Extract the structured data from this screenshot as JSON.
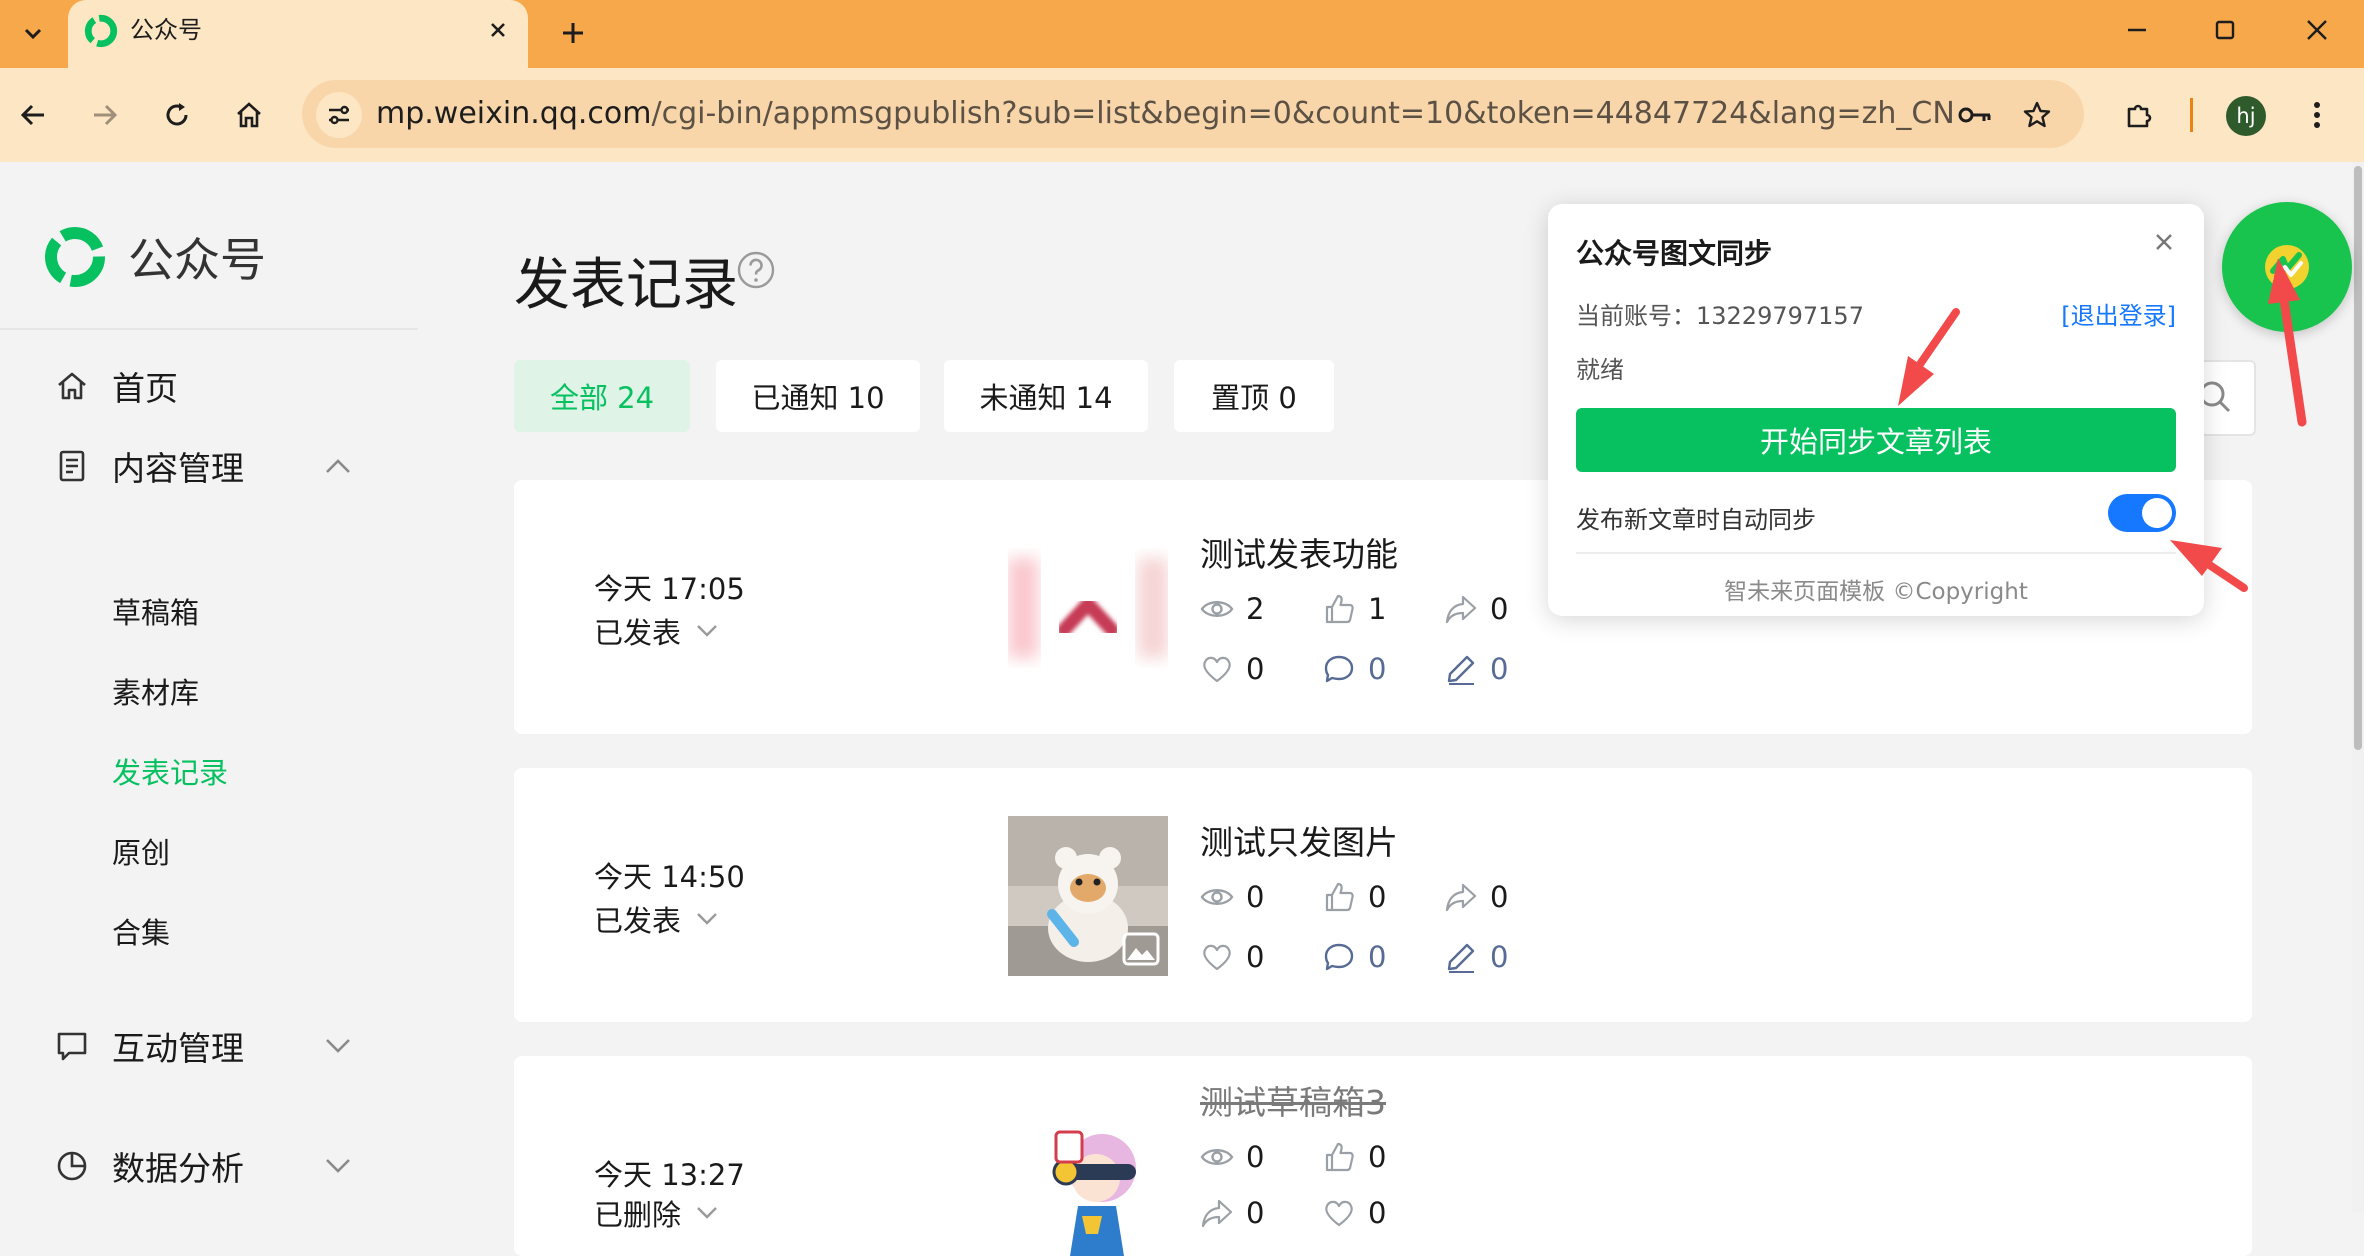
{
  "browser": {
    "tab_title": "公众号",
    "url_host": "mp.weixin.qq.com",
    "url_path": "/cgi-bin/appmsgpublish?sub=list&begin=0&count=10&token=44847724&lang=zh_CN",
    "profile_initials": "hj"
  },
  "sidebar": {
    "logo_text": "公众号",
    "home": "首页",
    "content_mgmt": "内容管理",
    "sub_items": [
      "草稿箱",
      "素材库",
      "发表记录",
      "原创",
      "合集"
    ],
    "interaction_mgmt": "互动管理",
    "data_analysis": "数据分析"
  },
  "main": {
    "page_title": "发表记录",
    "filters": [
      "全部 24",
      "已通知 10",
      "未通知 14",
      "置顶 0"
    ]
  },
  "articles": [
    {
      "time": "今天 17:05",
      "status": "已发表",
      "title": "测试发表功能",
      "reads": "2",
      "likes": "1",
      "shares": "0",
      "wows": "0",
      "comments": "0",
      "notes": "0"
    },
    {
      "time": "今天 14:50",
      "status": "已发表",
      "title": "测试只发图片",
      "reads": "0",
      "likes": "0",
      "shares": "0",
      "wows": "0",
      "comments": "0",
      "notes": "0"
    },
    {
      "time": "今天 13:27",
      "status": "已删除",
      "title": "测试草稿箱3",
      "reads": "0",
      "likes": "0",
      "shares": "0",
      "wows": "0"
    }
  ],
  "popup": {
    "title": "公众号图文同步",
    "account": "当前账号：13229797157",
    "logout": "[退出登录]",
    "status": "就绪",
    "sync_button": "开始同步文章列表",
    "auto_sync_label": "发布新文章时自动同步",
    "auto_sync_enabled": true,
    "footer": "智未来页面模板 ©Copyright"
  },
  "colors": {
    "brand_green": "#07c160",
    "link_blue": "#1677ff",
    "stat_blue": "#576b95",
    "annotation_red": "#f24a4a",
    "chrome_orange": "#f6a84b"
  }
}
